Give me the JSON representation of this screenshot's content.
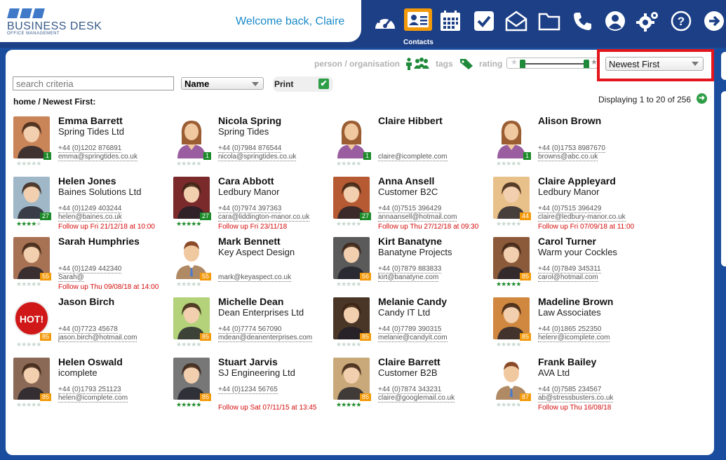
{
  "header": {
    "logo_title": "BUSINESS DESK",
    "logo_subtitle": "OFFICE MANAGEMENT",
    "welcome": "Welcome back, Claire",
    "active_label": "Contacts",
    "icons": [
      "dashboard-icon",
      "contacts-icon",
      "calendar-icon",
      "tasks-icon",
      "mail-icon",
      "folder-icon",
      "phone-icon",
      "user-icon",
      "settings-icon",
      "help-icon",
      "logout-icon"
    ]
  },
  "filters": {
    "person_org_label": "person / organisation",
    "tags_label": "tags",
    "rating_label": "rating",
    "sort_value": "Newest First",
    "search_placeholder": "search criteria",
    "sort_field": "Name",
    "print_label": "Print",
    "breadcrumb": "home / Newest First:",
    "displaying": "Displaying 1 to 20 of 256"
  },
  "colors": {
    "accent": "#f39a0a",
    "brand": "#1c3f86",
    "follow_up": "#d40d0d",
    "score_green": "#1d8b2a"
  },
  "contacts": [
    {
      "name": "Emma Barrett",
      "org": "Spring Tides Ltd",
      "phone": "+44 (0)1202 876891",
      "email": "emma@springtides.co.uk",
      "follow": "",
      "score": "1",
      "score_color": "green",
      "stars": 0,
      "avatar": "photo",
      "photo_bg": "#c98458"
    },
    {
      "name": "Nicola Spring",
      "org": "Spring Tides",
      "phone": "+44 (0)7984 876544",
      "email": "nicola@springtides.co.uk",
      "follow": "",
      "score": "1",
      "score_color": "green",
      "stars": 0,
      "avatar": "female",
      "photo_bg": ""
    },
    {
      "name": "Claire Hibbert",
      "org": "",
      "phone": "",
      "email": "claire@icomplete.com",
      "follow": "",
      "score": "1",
      "score_color": "green",
      "stars": 0,
      "avatar": "female",
      "photo_bg": ""
    },
    {
      "name": "Alison Brown",
      "org": "",
      "phone": "+44 (0)1753 8987670",
      "email": "browns@abc.co.uk",
      "follow": "",
      "score": "1",
      "score_color": "green",
      "stars": 0,
      "avatar": "female",
      "photo_bg": ""
    },
    {
      "name": "Helen Jones",
      "org": "Baines Solutions Ltd",
      "phone": "+44 (0)1249 403244",
      "email": "helen@baines.co.uk",
      "follow": "Follow up Fri 21/12/18 at 10:00",
      "score": "27",
      "score_color": "green",
      "stars": 4,
      "avatar": "photo",
      "photo_bg": "#9fb7c7"
    },
    {
      "name": "Cara Abbott",
      "org": "Ledbury Manor",
      "phone": "+44 (0)7974 397363",
      "email": "cara@liddington-manor.co.uk",
      "follow": "Follow up Fri 23/11/18",
      "score": "27",
      "score_color": "green",
      "stars": 5,
      "avatar": "photo",
      "photo_bg": "#7a2a2a"
    },
    {
      "name": "Anna Ansell",
      "org": "Customer B2C",
      "phone": "+44 (0)7515 396429",
      "email": "annaansell@hotmail.com",
      "follow": "Follow up Thu 27/12/18 at 09:30",
      "score": "27",
      "score_color": "green",
      "stars": 0,
      "avatar": "photo",
      "photo_bg": "#b55a32"
    },
    {
      "name": "Claire Appleyard",
      "org": "Ledbury Manor",
      "phone": "+44 (0)7515 396429",
      "email": "claire@ledbury-manor.co.uk",
      "follow": "Follow up Fri 07/09/18 at 11:00",
      "score": "44",
      "score_color": "orange",
      "stars": 0,
      "avatar": "photo",
      "photo_bg": "#e8c08a"
    },
    {
      "name": "Sarah Humphries",
      "org": "",
      "phone": "+44 (0)1249 442340",
      "email": "Sarah@",
      "follow": "Follow up Thu 09/08/18 at 14:00",
      "score": "55",
      "score_color": "orange",
      "stars": 0,
      "avatar": "photo",
      "photo_bg": "#a77253"
    },
    {
      "name": "Mark Bennett",
      "org": "Key Aspect Design",
      "phone": "",
      "email": "mark@keyaspect.co.uk",
      "follow": "",
      "score": "55",
      "score_color": "orange",
      "stars": 0,
      "avatar": "male",
      "photo_bg": ""
    },
    {
      "name": "Kirt Banatyne",
      "org": "Banatyne Projects",
      "phone": "+44 (0)7879 883833",
      "email": "kirt@banatyne.com",
      "follow": "",
      "score": "56",
      "score_color": "orange",
      "stars": 0,
      "avatar": "photo",
      "photo_bg": "#5a5a5a"
    },
    {
      "name": "Carol Turner",
      "org": "Warm your Cockles",
      "phone": "+44 (0)7849 345311",
      "email": "carol@hotmail.com",
      "follow": "",
      "score": "85",
      "score_color": "orange",
      "stars": 5,
      "avatar": "photo",
      "photo_bg": "#8a5a3a"
    },
    {
      "name": "Jason Birch",
      "org": "",
      "phone": "+44 (0)7723 45678",
      "email": "jason.birch@hotmail.com",
      "follow": "",
      "score": "85",
      "score_color": "orange",
      "stars": 0,
      "avatar": "hot",
      "photo_bg": "#d01818"
    },
    {
      "name": "Michelle Dean",
      "org": "Dean Enterprises Ltd",
      "phone": "+44 (0)7774 567090",
      "email": "mdean@deanenterprises.com",
      "follow": "",
      "score": "85",
      "score_color": "orange",
      "stars": 0,
      "avatar": "photo",
      "photo_bg": "#b3d27a"
    },
    {
      "name": "Melanie Candy",
      "org": "Candy IT Ltd",
      "phone": "+44 (0)7789 390315",
      "email": "melanie@candyit.com",
      "follow": "",
      "score": "85",
      "score_color": "orange",
      "stars": 0,
      "avatar": "photo",
      "photo_bg": "#4a3626"
    },
    {
      "name": "Madeline Brown",
      "org": "Law Associates",
      "phone": "+44 (0)1865 252350",
      "email": "helenr@icomplete.com",
      "follow": "",
      "score": "85",
      "score_color": "orange",
      "stars": 0,
      "avatar": "photo",
      "photo_bg": "#d08840"
    },
    {
      "name": "Helen Oswald",
      "org": "icomplete",
      "phone": "+44 (0)1793 251123",
      "email": "helen@icomplete.com",
      "follow": "",
      "score": "85",
      "score_color": "orange",
      "stars": 0,
      "avatar": "photo",
      "photo_bg": "#8a6a56"
    },
    {
      "name": "Stuart Jarvis",
      "org": "SJ Engineering Ltd",
      "phone": "+44 (0)1234 56765",
      "email": "",
      "follow": "Follow up Sat 07/11/15 at 13:45",
      "score": "85",
      "score_color": "orange",
      "stars": 5,
      "avatar": "photo",
      "photo_bg": "#777777"
    },
    {
      "name": "Claire Barrett",
      "org": "Customer B2B",
      "phone": "+44 (0)7874 343231",
      "email": "claire@googlemail.co.uk",
      "follow": "",
      "score": "85",
      "score_color": "orange",
      "stars": 5,
      "avatar": "photo",
      "photo_bg": "#c9a97a"
    },
    {
      "name": "Frank Bailey",
      "org": "AVA Ltd",
      "phone": "+44 (0)7585 234567",
      "email": "ab@stressbusters.co.uk",
      "follow": "Follow up Thu 16/08/18",
      "score": "87",
      "score_color": "orange",
      "stars": 0,
      "avatar": "male",
      "photo_bg": ""
    }
  ]
}
